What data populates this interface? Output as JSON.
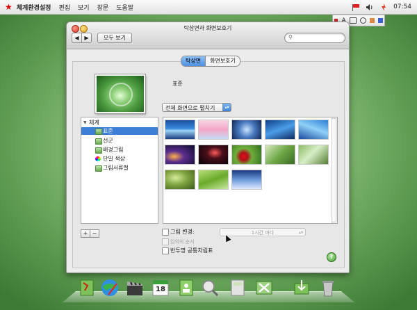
{
  "menubar": {
    "app_name": "체계환경설정",
    "items": [
      "편집",
      "보기",
      "창문",
      "도움말"
    ],
    "clock": "07:54"
  },
  "inputbar": {
    "label": "A"
  },
  "window": {
    "title": "탁상면과 화면보호기",
    "show_all_label": "모두 보기",
    "search": {
      "value": "",
      "placeholder": ""
    },
    "tabs": [
      {
        "label": "탁상면",
        "active": true
      },
      {
        "label": "화면보호기",
        "active": false
      }
    ],
    "current_wallpaper_name": "표준",
    "fit_option": "전체 화면으로 펼치기",
    "source_list": {
      "group": "체계",
      "items": [
        {
          "label": "표준",
          "selected": true
        },
        {
          "label": "선군",
          "selected": false
        },
        {
          "label": "배경그림",
          "selected": false
        },
        {
          "label": "단일 색상",
          "selected": false
        },
        {
          "label": "그림서류철",
          "selected": false
        }
      ]
    },
    "add_label": "+",
    "remove_label": "−",
    "change_picture": {
      "label": "그림 변경:",
      "checked": false,
      "interval": "1시간 마다"
    },
    "random_order": {
      "label": "임의의 순서",
      "checked": false,
      "enabled": false
    },
    "translucent_menubar": {
      "label": "반투명 공통차림표",
      "checked": false
    },
    "help_label": "?"
  },
  "dock": {
    "calendar_day": "18"
  },
  "colors": {
    "selection": "#3d7fd6",
    "desktop_green": "#8fc47e",
    "accent_red": "#dd0000"
  }
}
